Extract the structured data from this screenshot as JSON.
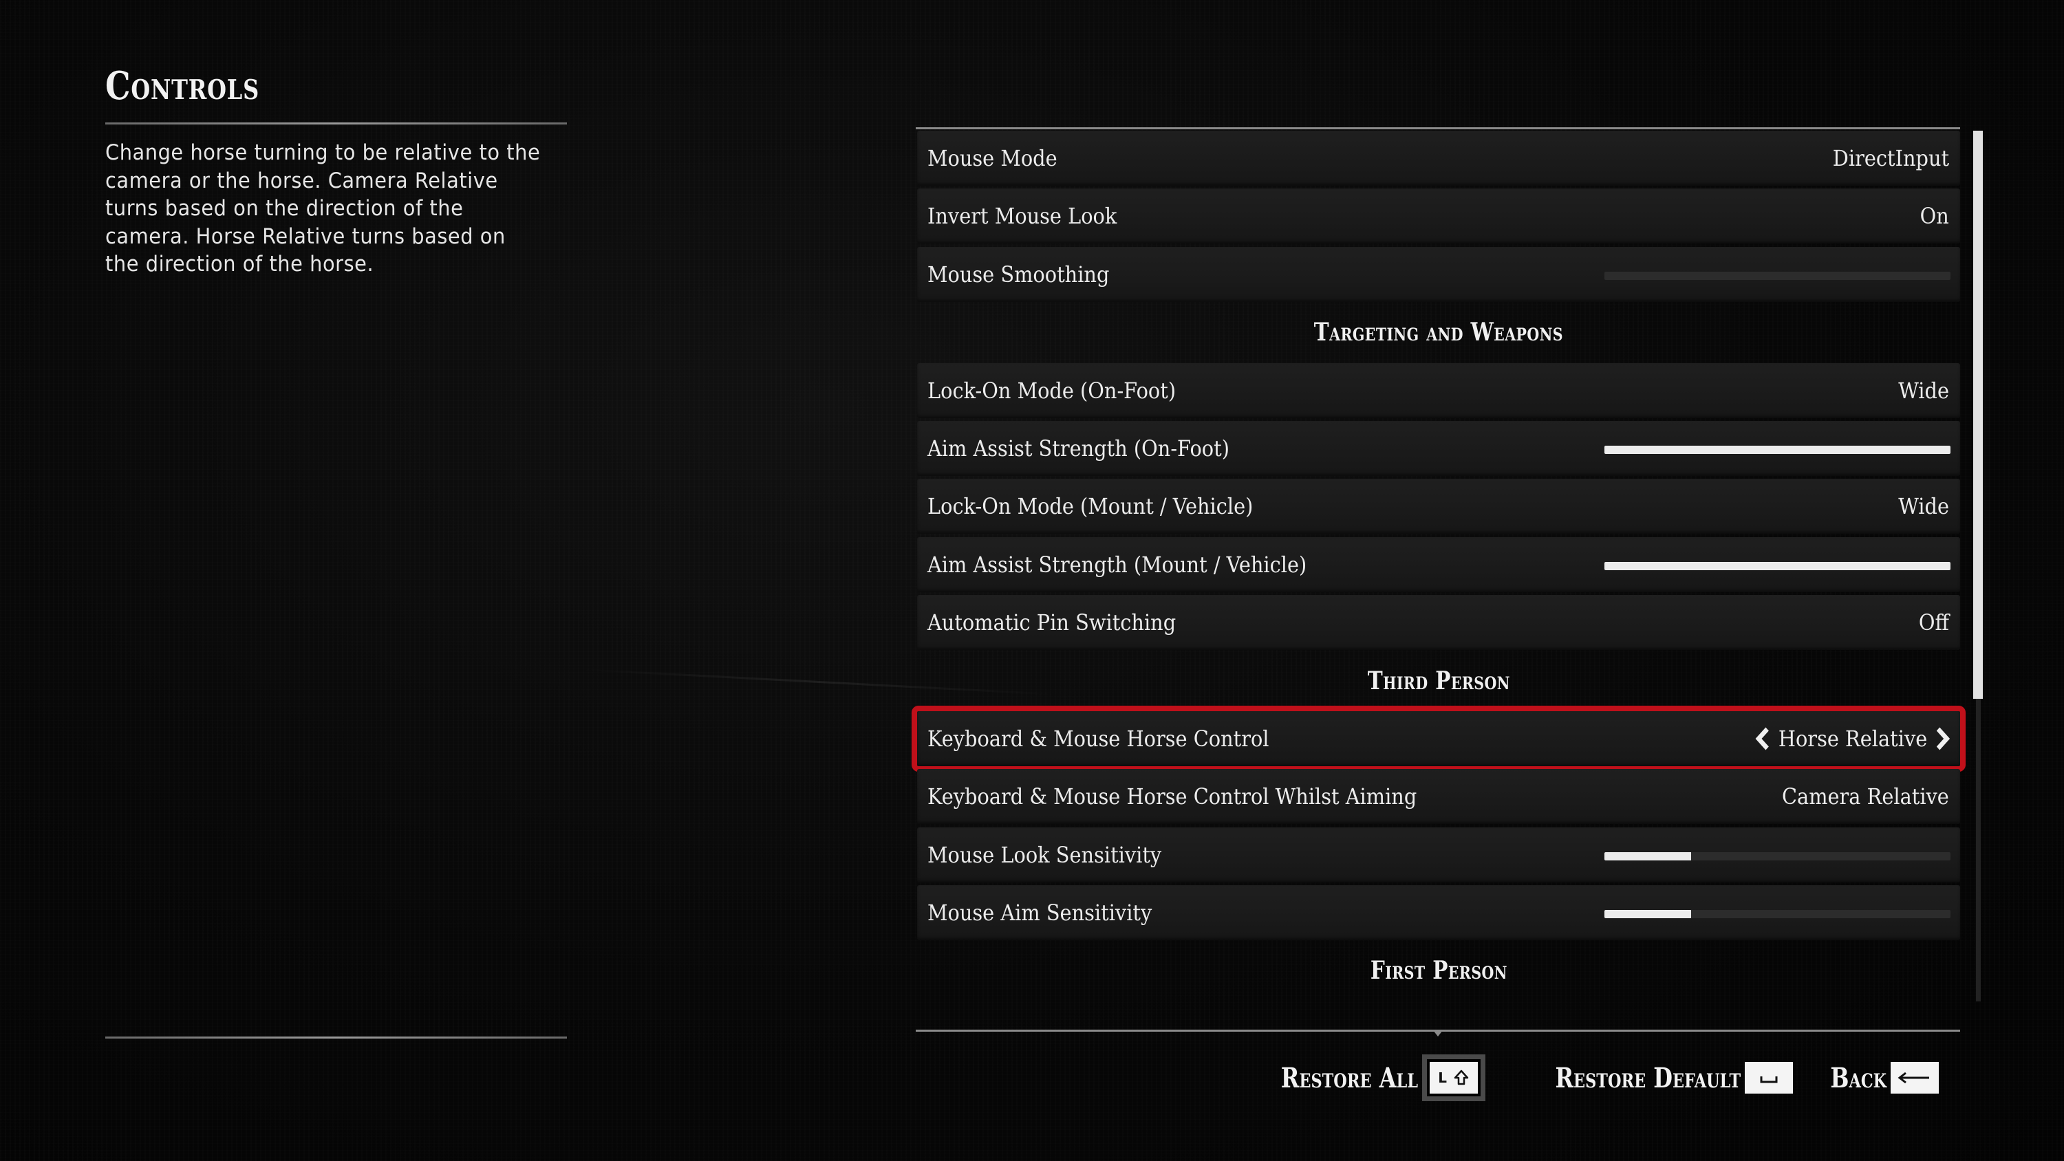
{
  "page": {
    "title": "Controls",
    "description": "Change horse turning to be relative to the camera or the horse. Camera Relative turns based on the direction of the camera. Horse Relative turns based on the direction of the horse."
  },
  "settings": [
    {
      "type": "row",
      "label": "Mouse Mode",
      "value": "DirectInput"
    },
    {
      "type": "row",
      "label": "Invert Mouse Look",
      "value": "On"
    },
    {
      "type": "slider",
      "label": "Mouse Smoothing",
      "level": 0.0
    },
    {
      "type": "section",
      "label": "Targeting and Weapons"
    },
    {
      "type": "row",
      "label": "Lock-On Mode (On-Foot)",
      "value": "Wide"
    },
    {
      "type": "slider",
      "label": "Aim Assist Strength (On-Foot)",
      "level": 1.0
    },
    {
      "type": "row",
      "label": "Lock-On Mode (Mount / Vehicle)",
      "value": "Wide"
    },
    {
      "type": "slider",
      "label": "Aim Assist Strength (Mount / Vehicle)",
      "level": 1.0
    },
    {
      "type": "row",
      "label": "Automatic Pin Switching",
      "value": "Off"
    },
    {
      "type": "section",
      "label": "Third Person"
    },
    {
      "type": "row",
      "label": "Keyboard & Mouse Horse Control",
      "value": "Horse Relative",
      "selected": true
    },
    {
      "type": "row",
      "label": "Keyboard & Mouse Horse Control Whilst Aiming",
      "value": "Camera Relative"
    },
    {
      "type": "slider",
      "label": "Mouse Look Sensitivity",
      "level": 0.25
    },
    {
      "type": "slider",
      "label": "Mouse Aim Sensitivity",
      "level": 0.25
    },
    {
      "type": "section",
      "label": "First Person"
    }
  ],
  "scroll": {
    "thumb_fraction": 0.65,
    "position": 0.0
  },
  "actions": {
    "restore_all": {
      "label": "Restore All",
      "key": "L",
      "key_icon": "shift-arrow-icon"
    },
    "restore_default": {
      "label": "Restore Default",
      "key_icon": "spacebar-icon"
    },
    "back": {
      "label": "Back",
      "key_icon": "backspace-arrow-icon"
    }
  },
  "colors": {
    "selection": "#c0101a",
    "text": "#ececec",
    "row_bg": "#1c1c1c",
    "slider_fill": "#ececec",
    "slider_track": "#2c2c2c"
  }
}
